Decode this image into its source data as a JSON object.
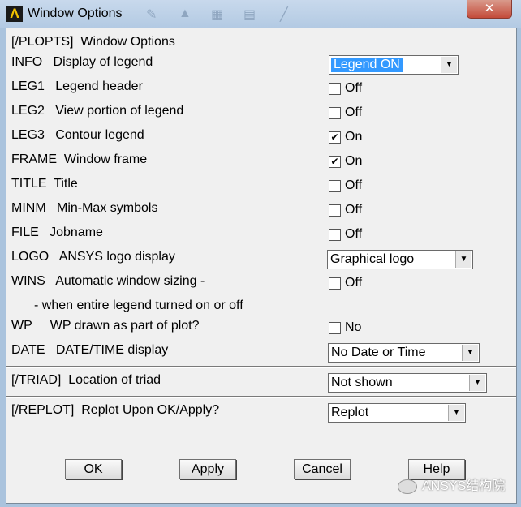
{
  "window": {
    "title": "Window Options",
    "close_glyph": "✕",
    "app_glyph": "Λ"
  },
  "section_plopts": {
    "header": "[/PLOPTS]  Window Options"
  },
  "rows": {
    "info": {
      "label": "INFO   Display of legend",
      "value": "Legend ON"
    },
    "leg1": {
      "label": "LEG1   Legend header",
      "state": "Off",
      "checked": false
    },
    "leg2": {
      "label": "LEG2   View portion of legend",
      "state": "Off",
      "checked": false
    },
    "leg3": {
      "label": "LEG3   Contour legend",
      "state": "On",
      "checked": true
    },
    "frame": {
      "label": "FRAME  Window frame",
      "state": "On",
      "checked": true
    },
    "title": {
      "label": "TITLE  Title",
      "state": "Off",
      "checked": false
    },
    "minm": {
      "label": "MINM   Min-Max symbols",
      "state": "Off",
      "checked": false
    },
    "file": {
      "label": "FILE   Jobname",
      "state": "Off",
      "checked": false
    },
    "logo": {
      "label": "LOGO   ANSYS logo display",
      "value": "Graphical logo"
    },
    "wins": {
      "label": "WINS   Automatic window sizing -",
      "sublabel": "- when entire legend turned on or off",
      "state": "Off",
      "checked": false
    },
    "wp": {
      "label": "WP     WP drawn as part of plot?",
      "state": "No",
      "checked": false
    },
    "date": {
      "label": "DATE   DATE/TIME display",
      "value": "No Date or Time"
    }
  },
  "triad": {
    "label": "[/TRIAD]  Location of triad",
    "value": "Not shown"
  },
  "replot": {
    "label": "[/REPLOT]  Replot Upon OK/Apply?",
    "value": "Replot"
  },
  "buttons": {
    "ok": "OK",
    "apply": "Apply",
    "cancel": "Cancel",
    "help": "Help"
  },
  "watermark": {
    "text": "ANSYS结构院"
  },
  "icons": {
    "checkmark": "✔",
    "dropdown": "▼"
  }
}
